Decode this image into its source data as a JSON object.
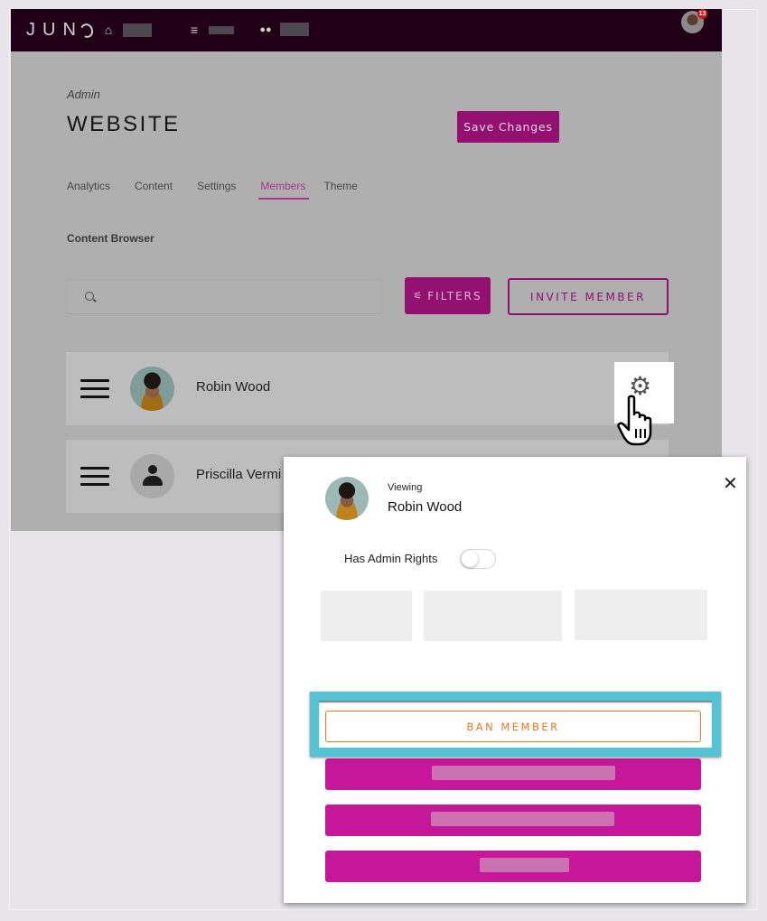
{
  "app": {
    "logo": "JUN",
    "nav": [
      {
        "icon": "home-icon",
        "glyph": "⌂",
        "label": ""
      },
      {
        "icon": "list-icon",
        "glyph": "≡",
        "label": ""
      },
      {
        "icon": "users-icon",
        "glyph": "👥",
        "label": ""
      }
    ],
    "notification_count": "13",
    "brand_color": "#931071",
    "header_color": "#210017"
  },
  "page": {
    "breadcrumb": "Admin",
    "title": "WEBSITE",
    "save_label": "Save Changes",
    "tabs": [
      {
        "label": "Analytics",
        "active": false
      },
      {
        "label": "Content",
        "active": false
      },
      {
        "label": "Settings",
        "active": false
      },
      {
        "label": "Members",
        "active": true
      },
      {
        "label": "Theme",
        "active": false
      }
    ],
    "section_label": "Content Browser",
    "search": {
      "placeholder": "",
      "value": ""
    },
    "filters_label": "FILTERS",
    "invite_label": "INVITE MEMBER",
    "members": [
      {
        "name": "Robin Wood",
        "has_photo": true
      },
      {
        "name": "Priscilla Vermi",
        "has_photo": false
      }
    ]
  },
  "modal": {
    "viewing_label": "Viewing",
    "member_name": "Robin Wood",
    "admin_rights_label": "Has Admin Rights",
    "admin_rights_enabled": false,
    "ban_label": "BAN MEMBER",
    "ban_color": "#f07522",
    "highlight_color": "#56c3d4",
    "action_color": "#c6179a"
  }
}
